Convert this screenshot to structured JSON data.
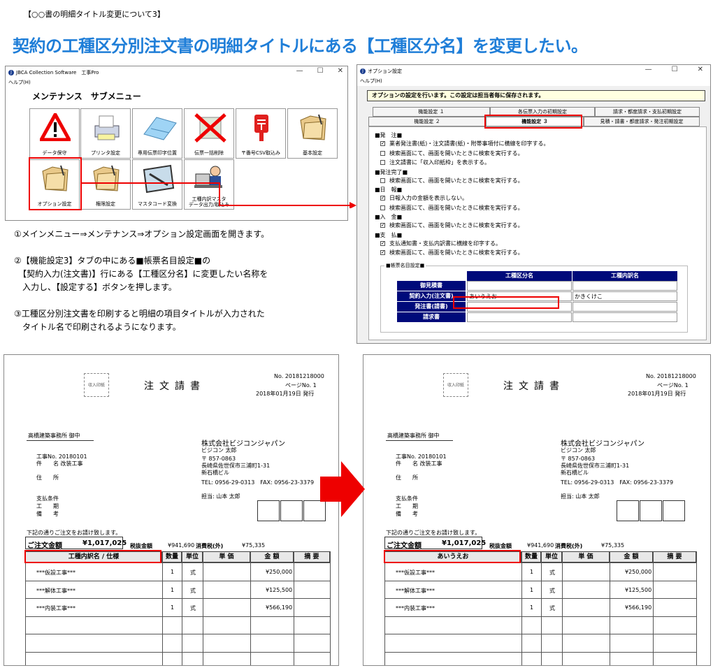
{
  "note": "【○○書の明細タイトル変更について3】",
  "headline": "契約の工種区分別注文書の明細タイトルにある【工種区分名】を変更したい。",
  "window1": {
    "title": "JBCA Collection Software　工事Pro",
    "menu": "ヘルプ(H)",
    "submenu_title": "メンテナンス　サブメニュー",
    "controls": [
      "—",
      "☐",
      "✕"
    ],
    "items": [
      {
        "label": "データ保守",
        "icon": "warning-icon"
      },
      {
        "label": "プリンタ設定",
        "icon": "printer-icon"
      },
      {
        "label": "専用伝票印字位置",
        "icon": "form-paper-icon"
      },
      {
        "label": "伝票一括削除",
        "icon": "delete-icon"
      },
      {
        "label": "〒番号CSV取込み",
        "icon": "postbox-icon"
      },
      {
        "label": "基本設定",
        "icon": "folder-icon"
      },
      {
        "label": "オプション設定",
        "icon": "folder-icon"
      },
      {
        "label": "権限設定",
        "icon": "folder-icon"
      },
      {
        "label": "マスタコード変換",
        "icon": "map-icon"
      },
      {
        "label": "工種内訳マスタ\nデータ出力/取込み",
        "icon": "person-computer-icon"
      }
    ]
  },
  "window2": {
    "title": "オプション設定",
    "menu": "ヘルプ(H)",
    "notice": "オプションの設定を行います。この設定は担当者毎に保存されます。",
    "tabs_row1": [
      "機能設定 １",
      "各伝票入力の初期設定",
      "請求・都度請求・支払初期設定"
    ],
    "tabs_row2": [
      "機能設定 ２",
      "機能設定 ３",
      "見積・請書・都度請求・発注初期設定"
    ],
    "sections": [
      {
        "heading": "■発　注■",
        "options": [
          {
            "text": "業者発注書(紙)・注文請書(紙)・附帯事項付に横線を印字する。",
            "checked": true
          },
          {
            "text": "検索画面にて、画面を開いたときに検索を実行する。",
            "checked": false
          },
          {
            "text": "注文請書に「収入印紙枠」を表示する。",
            "checked": false
          }
        ]
      },
      {
        "heading": "■発注完了■",
        "options": [
          {
            "text": "検索画面にて、画面を開いたときに検索を実行する。",
            "checked": false
          }
        ]
      },
      {
        "heading": "■日　報■",
        "options": [
          {
            "text": "日報入力の金額を表示しない。",
            "checked": true
          },
          {
            "text": "検索画面にて、画面を開いたときに検索を実行する。",
            "checked": false
          }
        ]
      },
      {
        "heading": "■入　金■",
        "options": [
          {
            "text": "検索画面にて、画面を開いたときに検索を実行する。",
            "checked": true
          }
        ]
      },
      {
        "heading": "■支　払■",
        "options": [
          {
            "text": "支払通知書・支払内訳書に横線を印字する。",
            "checked": true
          },
          {
            "text": "検索画面にて、画面を開いたときに検索を実行する。",
            "checked": true
          }
        ]
      }
    ],
    "group_label": "■帳票名目設定■",
    "grid": {
      "headers": [
        "工種区分名",
        "工種内訳名"
      ],
      "rows": [
        {
          "label": "御見積書",
          "col1": "",
          "col2": ""
        },
        {
          "label": "契約入力(注文書)",
          "col1": "あいうえお",
          "col2": "かきくけこ"
        },
        {
          "label": "発注書(請書)",
          "col1": "",
          "col2": ""
        },
        {
          "label": "請求書",
          "col1": "",
          "col2": ""
        }
      ]
    }
  },
  "instructions": [
    "①メインメニュー⇒メンテナンス⇒オプション設定画面を開きます。",
    "②【機能設定3】タブの中にある■帳票名目設定■の",
    "　【契約入力(注文書)】行にある【工種区分名】に変更したい名称を",
    "　入力し、【設定する】ボタンを押します。",
    "③工種区分別注文書を印刷すると明細の項目タイトルが入力された",
    "　タイトル名で印刷されるようになります。"
  ],
  "document": {
    "stamp": "収入印紙",
    "title": "注文請書",
    "number": "No. 20181218000",
    "page": "ページNo. 1",
    "issued": "2018年01月19日 発行",
    "recipient": "高橋建築事務所 御中",
    "job_no": "工事No. 20180101",
    "job_name": "件　　名 改装工事",
    "address_label": "住　　所",
    "company": "株式会社ビジコンジャパン",
    "person": "ビジコン 太郎",
    "postal": "〒 857-0863",
    "addr1": "長崎県佐世保市三浦町1-31",
    "addr2": "新石橋ビル",
    "phone": "TEL: 0956-29-0313　FAX: 0956-23-3379",
    "staff": "担当: 山本 太郎",
    "terms": [
      "支払条件",
      "工　　期",
      "備　　考"
    ],
    "intro": "下記の通りご注文をお請け致します。",
    "total_label": "ご注文金額",
    "total": "¥1,017,025",
    "excl_label": "税抜金額",
    "excl": "¥941,690",
    "tax_label": "消費税(外)",
    "tax": "¥75,335",
    "headers_before": "工種内訳名 / 仕様",
    "headers_after": "あいうえお",
    "headers": [
      "数量",
      "単位",
      "単 価",
      "金 額",
      "摘 要"
    ],
    "lines": [
      {
        "name": "***仮設工事***",
        "qty": "1",
        "unit": "式",
        "amount": "¥250,000"
      },
      {
        "name": "***解体工事***",
        "qty": "1",
        "unit": "式",
        "amount": "¥125,500"
      },
      {
        "name": "***内装工事***",
        "qty": "1",
        "unit": "式",
        "amount": "¥566,190"
      }
    ]
  },
  "colors": {
    "accent": "#1f7ed8",
    "highlight": "#e00000",
    "grid_header": "#000a7a"
  }
}
